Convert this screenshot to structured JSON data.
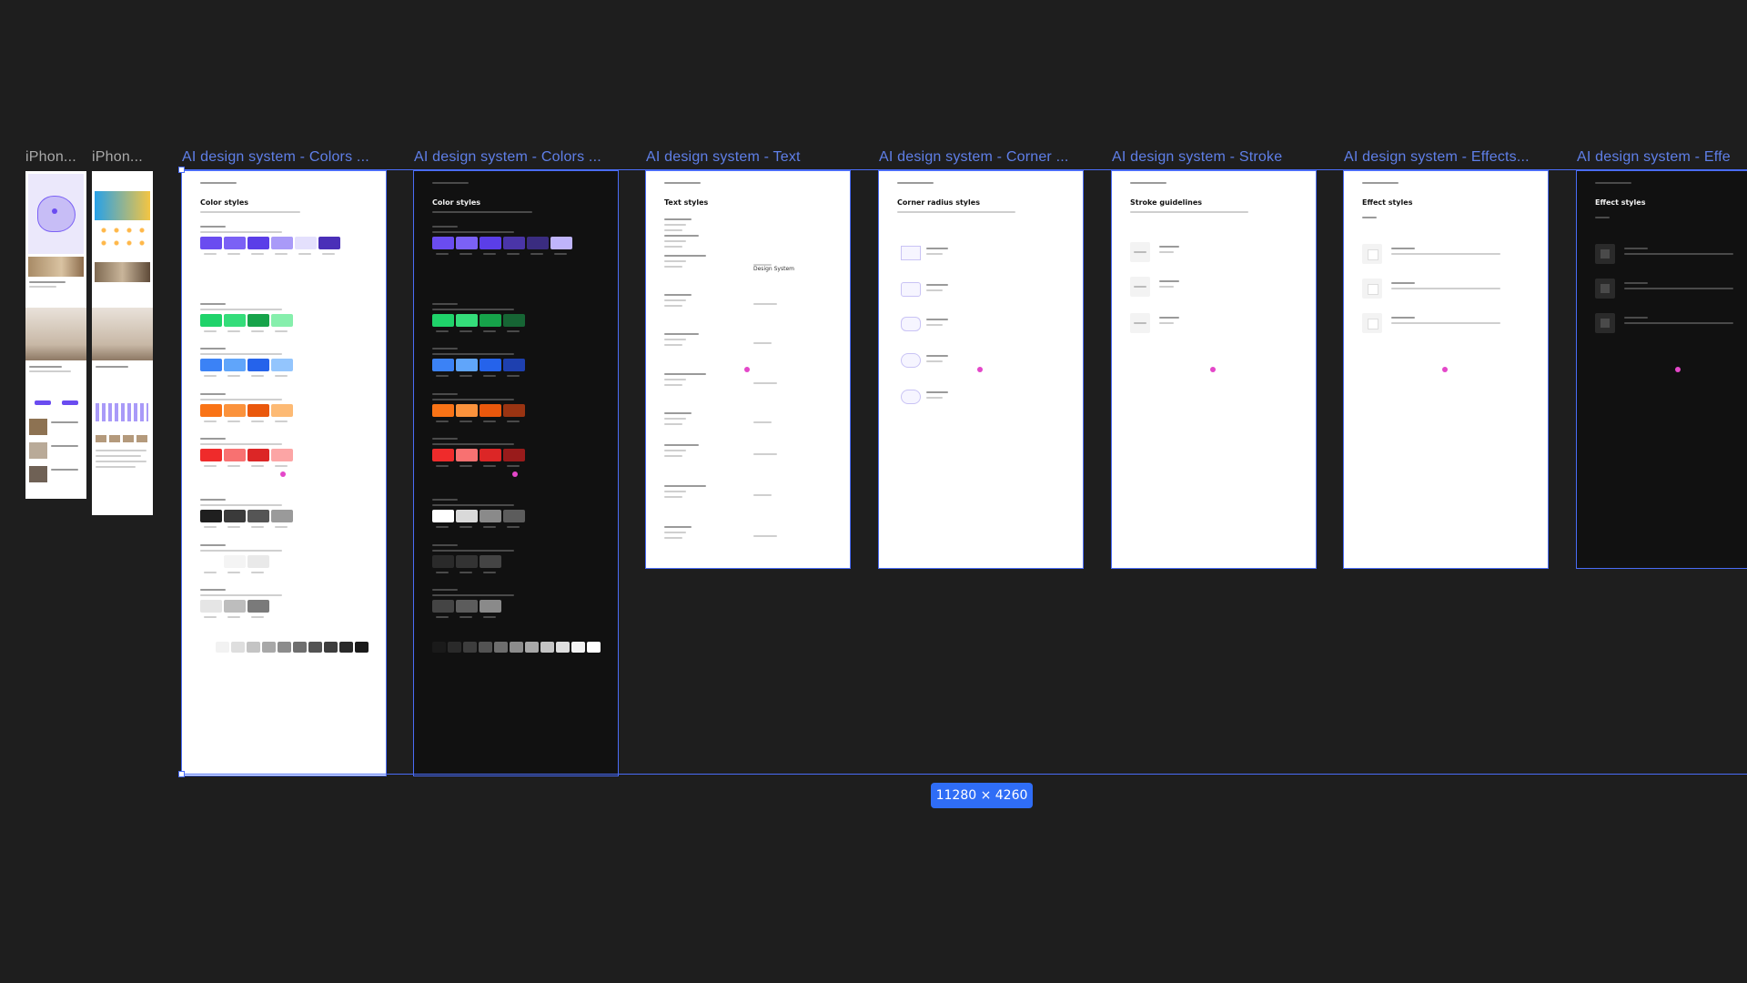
{
  "canvas": {
    "background": "#1e1e1e",
    "selection_size": "11280 × 4260"
  },
  "frames": [
    {
      "label": "iPhon...",
      "mode": "light",
      "kind": "phone"
    },
    {
      "label": "iPhon...",
      "mode": "light",
      "kind": "phone"
    },
    {
      "label": "AI design system - Colors ...",
      "mode": "light",
      "kind": "colors",
      "title": "Color styles"
    },
    {
      "label": "AI design system - Colors ...",
      "mode": "dark",
      "kind": "colors",
      "title": "Color styles"
    },
    {
      "label": "AI design system - Text",
      "mode": "light",
      "kind": "text",
      "title": "Text styles",
      "sample": "Design System"
    },
    {
      "label": "AI design system - Corner ...",
      "mode": "light",
      "kind": "corner",
      "title": "Corner radius styles"
    },
    {
      "label": "AI design system - Stroke",
      "mode": "light",
      "kind": "stroke",
      "title": "Stroke guidelines"
    },
    {
      "label": "AI design system - Effects...",
      "mode": "light",
      "kind": "effects",
      "title": "Effect styles"
    },
    {
      "label": "AI design system - Effe",
      "mode": "dark",
      "kind": "effects",
      "title": "Effect styles"
    }
  ],
  "colors": {
    "brand": [
      "#6a4cf0",
      "#7b61f5",
      "#5b3ee8",
      "#a99af8",
      "#e4e0fd",
      "#4a2fb8"
    ],
    "brand_dark": [
      "#6a4cf0",
      "#7b61f5",
      "#5b3ee8",
      "#4a35a8",
      "#3a2c80",
      "#bfb4fb"
    ],
    "success": [
      "#1fd36a",
      "#34dd7a",
      "#16a34a",
      "#86efac"
    ],
    "success_dark": [
      "#1fd36a",
      "#34dd7a",
      "#16a34a",
      "#166534"
    ],
    "information": [
      "#3b82f6",
      "#60a5fa",
      "#2563eb",
      "#93c5fd"
    ],
    "information_dark": [
      "#3b82f6",
      "#60a5fa",
      "#2563eb",
      "#1e40af"
    ],
    "warning": [
      "#f97316",
      "#fb923c",
      "#ea580c",
      "#fdba74"
    ],
    "warning_dark": [
      "#f97316",
      "#fb923c",
      "#ea580c",
      "#9a3412"
    ],
    "danger": [
      "#ef2b2b",
      "#f87171",
      "#dc2626",
      "#fca5a5"
    ],
    "danger_dark": [
      "#ef2b2b",
      "#f87171",
      "#dc2626",
      "#991b1b"
    ],
    "text_swatches": [
      "#1f1f1f",
      "#3a3a3a",
      "#555555",
      "#9a9a9a"
    ],
    "text_swatches_dark": [
      "#ffffff",
      "#d9d9d9",
      "#8a8a8a",
      "#5c5c5c"
    ],
    "bg_swatches": [
      "#ffffff",
      "#f4f4f4",
      "#e9e9e9"
    ],
    "bg_swatches_dark": [
      "#2a2a2a",
      "#333333",
      "#444444"
    ],
    "stroke_swatches": [
      "#e5e5e5",
      "#bdbdbd",
      "#7a7a7a"
    ],
    "stroke_swatches_dark": [
      "#444444",
      "#5c5c5c",
      "#8a8a8a"
    ],
    "gray_scale": [
      "#ffffff",
      "#f2f2f2",
      "#dedede",
      "#c4c4c4",
      "#a8a8a8",
      "#8c8c8c",
      "#6e6e6e",
      "#535353",
      "#3d3d3d",
      "#2a2a2a",
      "#1a1a1a"
    ],
    "pink": "#e447c9",
    "selection_blue": "#4a6cf7"
  }
}
